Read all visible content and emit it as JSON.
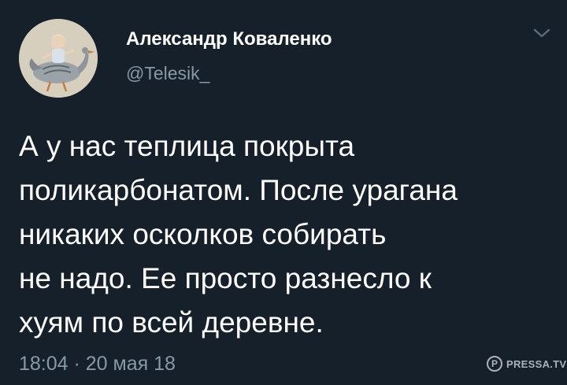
{
  "tweet": {
    "display_name": "Александр Коваленко",
    "handle": "@Telesik_",
    "text": "А у нас теплица покрыта\nполикарбонатом. После урагана\nникаких осколков собирать\nне надо. Ее просто разнесло к\nхуям по всей деревне.",
    "timestamp": "18:04 · 20 мая 18"
  },
  "watermark": {
    "logo_letter": "P",
    "text": "PRESSA.TV"
  },
  "icons": {
    "avatar": "avatar-illustration-icon",
    "more": "chevron-down-icon"
  },
  "colors": {
    "background": "#15202b",
    "primary_text": "#ffffff",
    "secondary_text": "#8899a6"
  }
}
